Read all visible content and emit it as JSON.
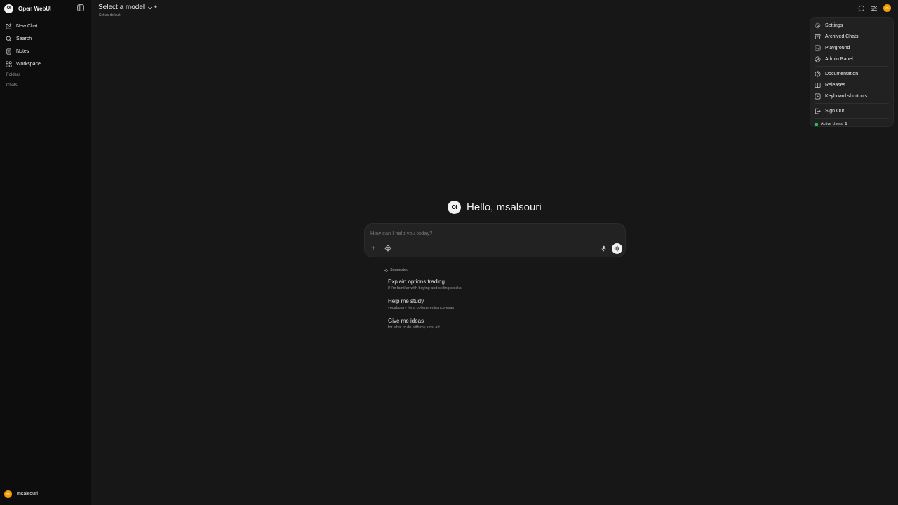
{
  "app": {
    "brand": "Open WebUI",
    "logo": "OI"
  },
  "sidebar": {
    "items": [
      {
        "label": "New Chat",
        "icon": "pencil-square-icon"
      },
      {
        "label": "Search",
        "icon": "search-icon"
      },
      {
        "label": "Notes",
        "icon": "notes-icon"
      },
      {
        "label": "Workspace",
        "icon": "workspace-icon"
      }
    ],
    "folders_label": "Folders",
    "chats_label": "Chats",
    "user": {
      "name": "msalsouri",
      "initials": "m"
    }
  },
  "header": {
    "model_label": "Select a model",
    "set_default": "Set as default",
    "user_initials": "m"
  },
  "menu": {
    "items": [
      {
        "label": "Settings",
        "icon": "gear-icon"
      },
      {
        "label": "Archived Chats",
        "icon": "archive-icon"
      },
      {
        "label": "Playground",
        "icon": "code-icon"
      },
      {
        "label": "Admin Panel",
        "icon": "user-circle-icon"
      }
    ],
    "items2": [
      {
        "label": "Documentation",
        "icon": "question-icon"
      },
      {
        "label": "Releases",
        "icon": "book-icon"
      },
      {
        "label": "Keyboard shortcuts",
        "icon": "keyboard-icon"
      }
    ],
    "signout": "Sign Out",
    "active_users_label": "Active Users:",
    "active_users_count": "1"
  },
  "main": {
    "greeting": "Hello, msalsouri",
    "composer_placeholder": "How can I help you today?",
    "suggested_label": "Suggested",
    "suggestions": [
      {
        "title": "Explain options trading",
        "subtitle": "if I'm familiar with buying and selling stocks"
      },
      {
        "title": "Help me study",
        "subtitle": "vocabulary for a college entrance exam"
      },
      {
        "title": "Give me ideas",
        "subtitle": "for what to do with my kids' art"
      }
    ]
  },
  "colors": {
    "accent": "#f59e0b",
    "online": "#22c55e",
    "background": "#171717",
    "sidebar": "#0d0d0d"
  }
}
